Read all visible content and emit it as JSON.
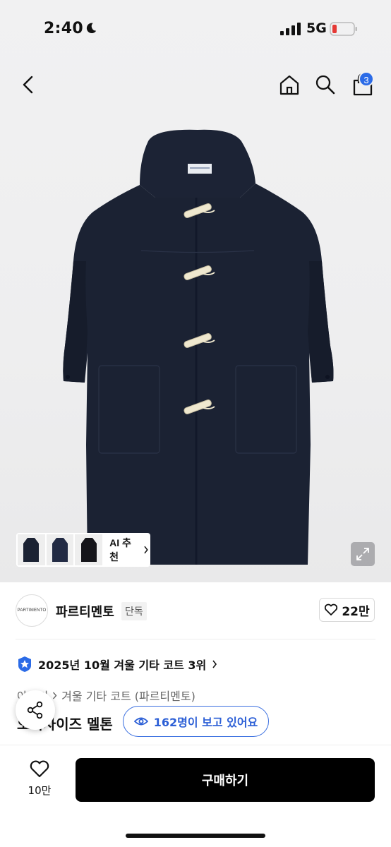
{
  "status_bar": {
    "time": "2:40",
    "network": "5G",
    "battery_color": "#e53935"
  },
  "nav": {
    "cart_count": "3",
    "icons": [
      "back-icon",
      "home-icon",
      "search-icon",
      "cart-icon"
    ]
  },
  "gallery": {
    "thumbnails": [
      "thumb-1",
      "thumb-2",
      "thumb-3"
    ],
    "ai_recommend_label": "AI 추천"
  },
  "seller": {
    "logo_text": "PARTIMENTO",
    "name": "파르티멘토",
    "tag": "단독",
    "likes": "22만"
  },
  "ranking": {
    "text": "2025년 10월 겨울 기타 코트 3위"
  },
  "breadcrumb": {
    "parent": "아우터",
    "current": "겨울 기타 코트 (파르티멘토)"
  },
  "product": {
    "title_partial": "오버사이즈 멜톤"
  },
  "viewing": {
    "text": "162명이 보고 있어요"
  },
  "bottom": {
    "favorite_count": "10만",
    "buy_label": "구매하기"
  },
  "colors": {
    "accent": "#2b6be7",
    "coat": "#1b2233",
    "toggle": "#efe8cf"
  }
}
